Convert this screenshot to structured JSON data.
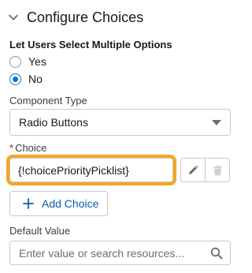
{
  "section": {
    "title": "Configure Choices",
    "expanded": true
  },
  "multi_select": {
    "label": "Let Users Select Multiple Options",
    "options": [
      {
        "label": "Yes",
        "checked": false
      },
      {
        "label": "No",
        "checked": true
      }
    ]
  },
  "component_type": {
    "label": "Component Type",
    "value": "Radio Buttons"
  },
  "choice": {
    "required_marker": "*",
    "label": "Choice",
    "value": "{!choicePriorityPicklist}",
    "highlight_color": "#f5a623",
    "actions": [
      {
        "icon": "pencil-icon",
        "enabled": true
      },
      {
        "icon": "trash-icon",
        "enabled": false
      }
    ]
  },
  "add_choice": {
    "label": "Add Choice"
  },
  "default_value": {
    "label": "Default Value",
    "placeholder": "Enter value or search resources..."
  },
  "colors": {
    "accent": "#0176d3",
    "link": "#0b5cab",
    "required": "#ba0517"
  }
}
